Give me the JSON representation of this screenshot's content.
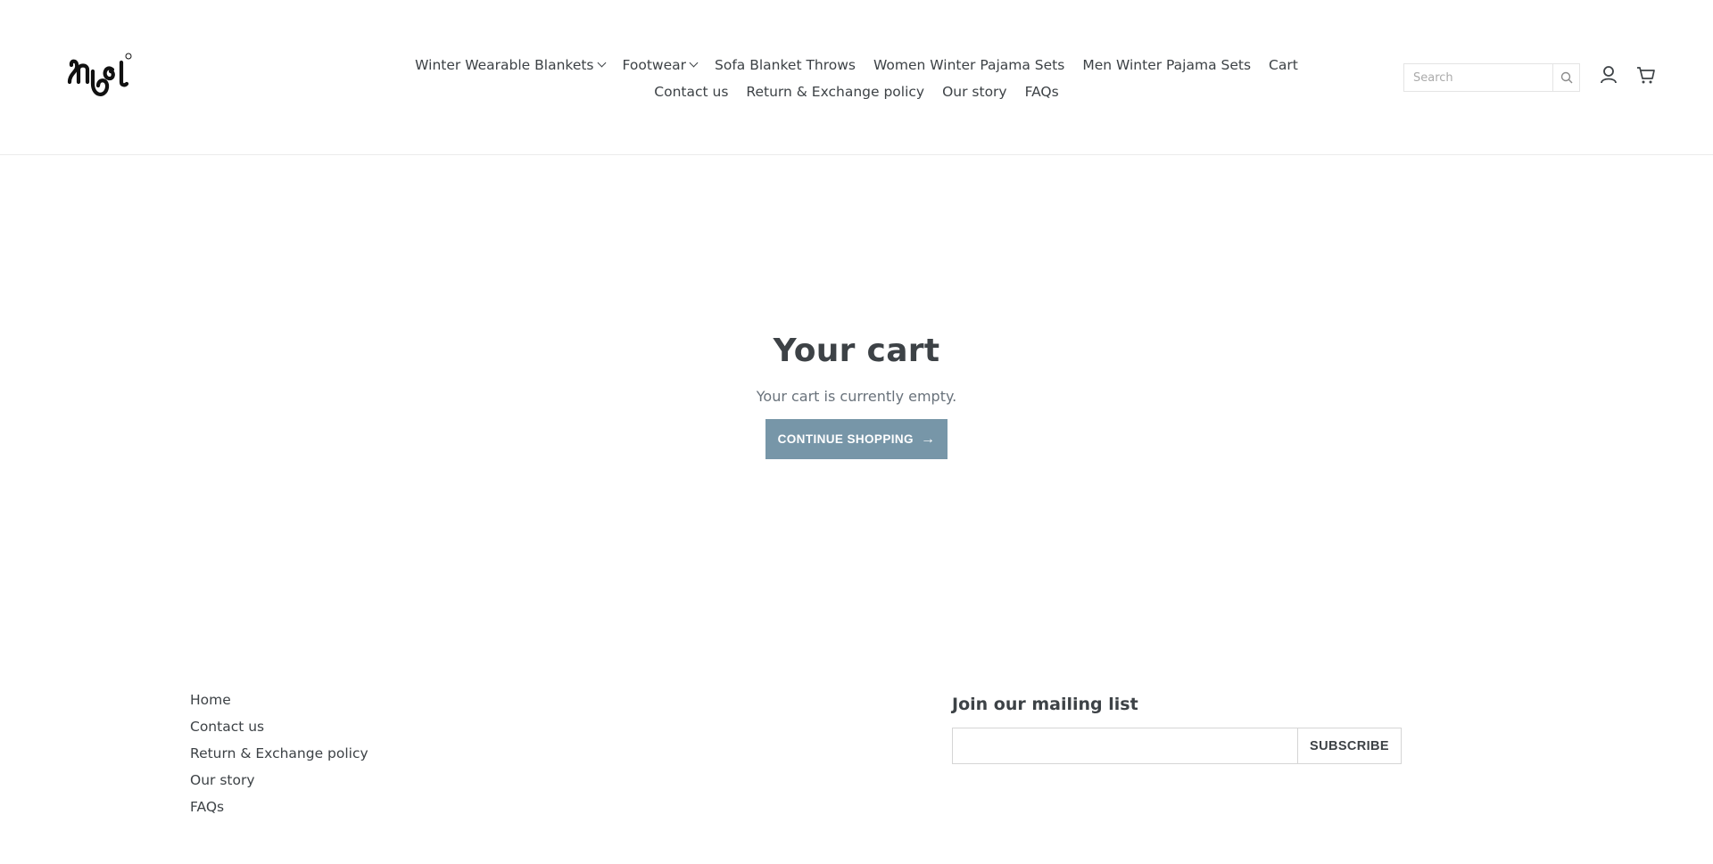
{
  "logo": {
    "icon": "snugl-logo"
  },
  "nav": {
    "row1": [
      {
        "label": "Winter Wearable Blankets",
        "dropdown": true
      },
      {
        "label": "Footwear",
        "dropdown": true
      },
      {
        "label": "Sofa Blanket Throws",
        "dropdown": false
      },
      {
        "label": "Women Winter Pajama Sets",
        "dropdown": false
      },
      {
        "label": "Men Winter Pajama Sets",
        "dropdown": false
      },
      {
        "label": "Cart",
        "dropdown": false
      }
    ],
    "row2": [
      {
        "label": "Contact us"
      },
      {
        "label": "Return & Exchange policy"
      },
      {
        "label": "Our story"
      },
      {
        "label": "FAQs"
      }
    ]
  },
  "search": {
    "placeholder": "Search",
    "value": ""
  },
  "icons": {
    "search": "search-icon",
    "account": "account-icon",
    "cart": "cart-icon"
  },
  "main": {
    "title": "Your cart",
    "empty_text": "Your cart is currently empty.",
    "continue_label": "CONTINUE SHOPPING",
    "continue_arrow": "→"
  },
  "footer": {
    "links": [
      "Home",
      "Contact us",
      "Return & Exchange policy",
      "Our story",
      "FAQs"
    ],
    "mailing_title": "Join our mailing list",
    "email_value": "",
    "subscribe_label": "SUBSCRIBE"
  },
  "colors": {
    "button": "#7796a8",
    "text": "#3d4246",
    "muted": "#69727b"
  }
}
